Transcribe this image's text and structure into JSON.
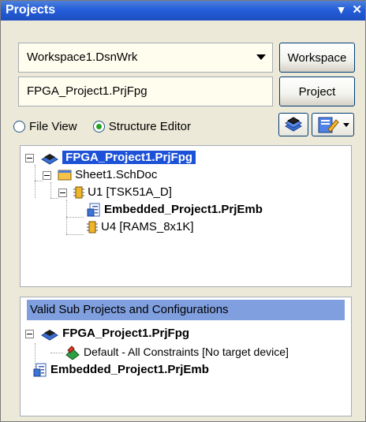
{
  "panel": {
    "title": "Projects",
    "menu_icon": "dropdown-arrow-icon",
    "close_icon": "close-icon"
  },
  "workspace": {
    "current": "Workspace1.DsnWrk",
    "button_label": "Workspace"
  },
  "project": {
    "current": "FPGA_Project1.PrjFpg",
    "button_label": "Project"
  },
  "view_mode": {
    "options": [
      "File View",
      "Structure Editor"
    ],
    "selected": "Structure Editor"
  },
  "tree": {
    "items": [
      {
        "label": "FPGA_Project1.PrjFpg",
        "icon": "fpga-project-icon",
        "selected": true
      },
      {
        "label": "Sheet1.SchDoc",
        "icon": "schematic-sheet-icon"
      },
      {
        "label": "U1 [TSK51A_D]",
        "icon": "component-icon"
      },
      {
        "label": "Embedded_Project1.PrjEmb",
        "icon": "embedded-project-icon"
      },
      {
        "label": "U4 [RAMS_8x1K]",
        "icon": "component-icon"
      }
    ]
  },
  "sub_projects": {
    "header": "Valid Sub Projects and Configurations",
    "items": [
      {
        "label": "FPGA_Project1.PrjFpg",
        "icon": "fpga-project-icon"
      },
      {
        "label": "Default - All Constraints [No target device]",
        "icon": "configuration-icon"
      },
      {
        "label": "Embedded_Project1.PrjEmb",
        "icon": "embedded-project-icon"
      }
    ]
  },
  "colors": {
    "title_bar": "#245edb",
    "selection": "#1c52d8",
    "list_header": "#7f9fdf",
    "panel_bg": "#ece9d8"
  }
}
